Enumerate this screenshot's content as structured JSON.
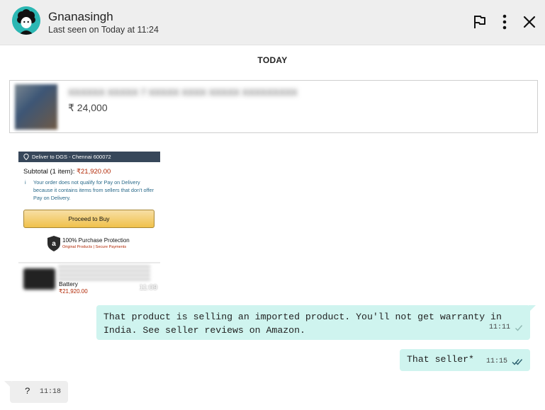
{
  "header": {
    "contact_name": "Gnanasingh",
    "last_seen": "Last seen on Today at 11:24",
    "icons": [
      "flag-icon",
      "more-vertical-icon",
      "close-icon"
    ]
  },
  "day_label": "TODAY",
  "product_card": {
    "title_blurred": "XXXXXX XXXXX 7 XXXXX XXXX XXXXX XXXXXXXXX",
    "price": "₹ 24,000"
  },
  "image_message": {
    "deliver_to": "Deliver to DGS - Chennai 600072",
    "subtotal_label": "Subtotal (1 item):",
    "subtotal_amount": "₹21,920.00",
    "note": "Your order does not qualify for Pay on Delivery because it contains items from sellers that don't offer Pay on Delivery.",
    "buy_button": "Proceed to Buy",
    "protection_title": "100% Purchase Protection",
    "protection_sub": "Original Products | Secure Payments",
    "item_name": "Battery",
    "item_price": "₹21,920.00",
    "time": "11:09"
  },
  "messages": [
    {
      "direction": "out",
      "text": "That product is selling an imported product. You'll not get warranty in India. See seller reviews on Amazon.",
      "time": "11:11",
      "status": "sent"
    },
    {
      "direction": "out",
      "text": "That seller*",
      "time": "11:15",
      "status": "delivered"
    },
    {
      "direction": "in",
      "text": "?",
      "time": "11:18"
    }
  ],
  "colors": {
    "header_bg": "#eeeeee",
    "avatar_bg": "#2bb7b3",
    "outgoing_bubble": "#cff4ef",
    "incoming_bubble": "#eeeeee",
    "amazon_header": "#37475a",
    "amazon_price": "#b12704"
  }
}
